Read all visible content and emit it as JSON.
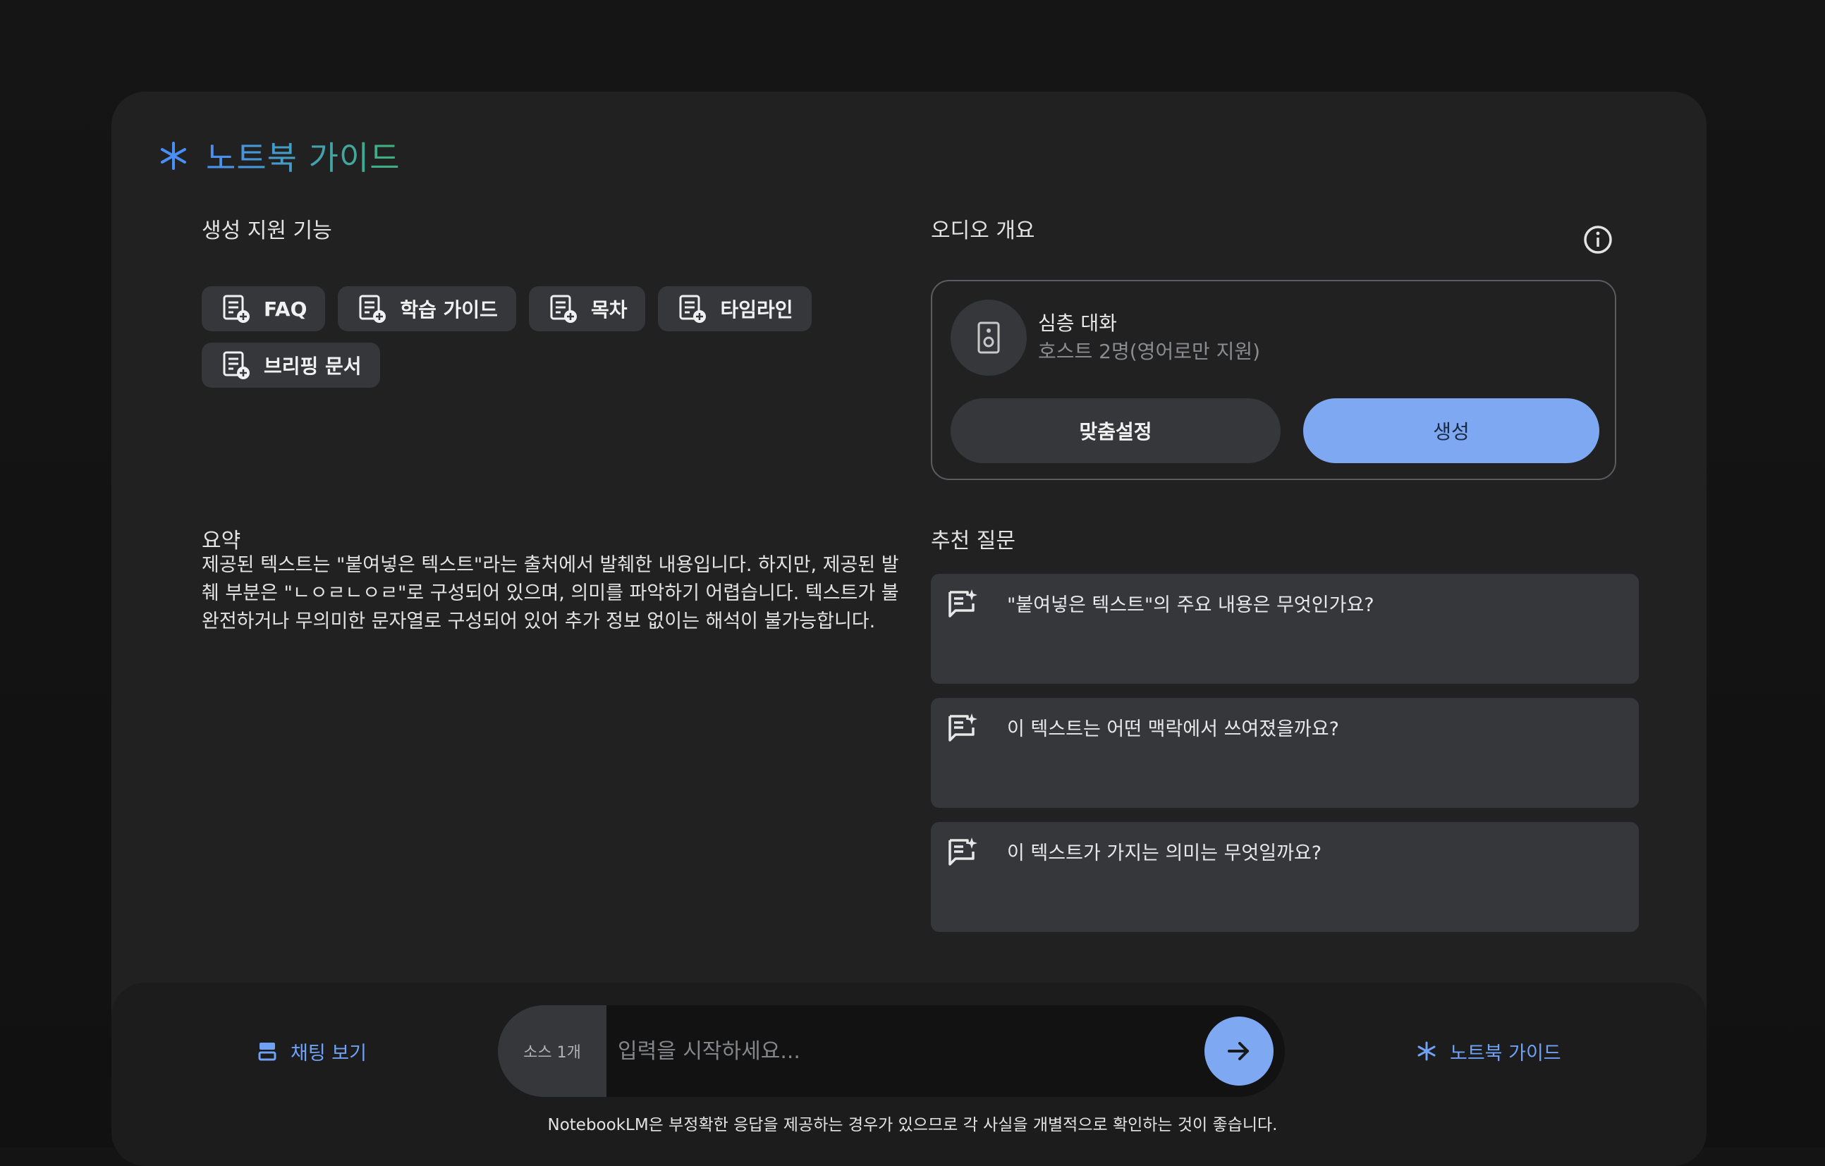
{
  "header": {
    "title": "노트북 가이드"
  },
  "generate": {
    "label": "생성 지원 기능",
    "chips": [
      "FAQ",
      "학습 가이드",
      "목차",
      "타임라인",
      "브리핑 문서"
    ]
  },
  "audio": {
    "label": "오디오 개요",
    "title": "심층 대화",
    "subtitle": "호스트 2명(영어로만 지원)",
    "customize_label": "맞춤설정",
    "generate_label": "생성"
  },
  "summary": {
    "label": "요약",
    "text": "제공된 텍스트는 \"붙여넣은 텍스트\"라는 출처에서 발췌한 내용입니다. 하지만, 제공된 발췌 부분은 \"ㄴㅇㄹㄴㅇㄹ\"로 구성되어 있으며, 의미를 파악하기 어렵습니다. 텍스트가 불완전하거나 무의미한 문자열로 구성되어 있어 추가 정보 없이는 해석이 불가능합니다."
  },
  "suggested": {
    "label": "추천 질문",
    "questions": [
      "\"붙여넣은 텍스트\"의 주요 내용은 무엇인가요?",
      "이 텍스트는 어떤 맥락에서 쓰여졌을까요?",
      "이 텍스트가 가지는 의미는 무엇일까요?"
    ]
  },
  "chat": {
    "view_label": "채팅 보기",
    "source_count": "소스 1개",
    "placeholder": "입력을 시작하세요...",
    "guide_label": "노트북 가이드",
    "disclaimer": "NotebookLM은 부정확한 응답을 제공하는 경우가 있으므로 각 사실을 개별적으로 확인하는 것이 좋습니다."
  },
  "colors": {
    "accent": "#7ea8f2",
    "link": "#6fa2f5",
    "chip_bg": "#35373b",
    "panel_bg": "#212121"
  }
}
